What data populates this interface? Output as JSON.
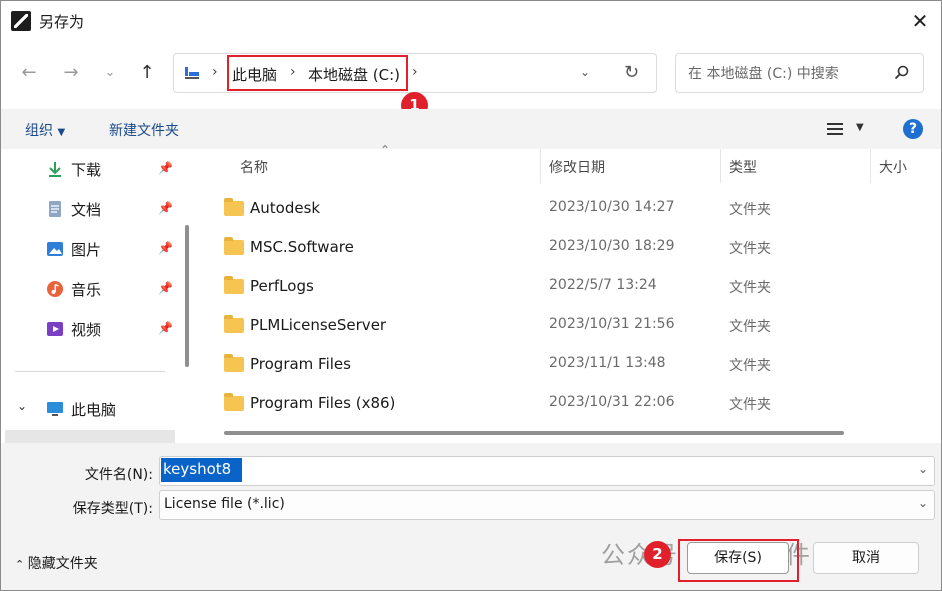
{
  "window": {
    "title": "另存为"
  },
  "nav": {
    "breadcrumbs": [
      "此电脑",
      "本地磁盘 (C:)"
    ],
    "search_placeholder": "在 本地磁盘 (C:) 中搜索"
  },
  "toolbar": {
    "organize": "组织",
    "new_folder": "新建文件夹"
  },
  "sidebar": {
    "items": [
      {
        "label": "下载",
        "icon": "download-icon",
        "pinned": true
      },
      {
        "label": "文档",
        "icon": "document-icon",
        "pinned": true
      },
      {
        "label": "图片",
        "icon": "picture-icon",
        "pinned": true
      },
      {
        "label": "音乐",
        "icon": "music-icon",
        "pinned": true
      },
      {
        "label": "视频",
        "icon": "video-icon",
        "pinned": true
      }
    ],
    "this_pc": "此电脑"
  },
  "file_list": {
    "columns": [
      "名称",
      "修改日期",
      "类型",
      "大小"
    ],
    "rows": [
      {
        "name": "Autodesk",
        "date": "2023/10/30 14:27",
        "type": "文件夹"
      },
      {
        "name": "MSC.Software",
        "date": "2023/10/30 18:29",
        "type": "文件夹"
      },
      {
        "name": "PerfLogs",
        "date": "2022/5/7 13:24",
        "type": "文件夹"
      },
      {
        "name": "PLMLicenseServer",
        "date": "2023/10/31 21:56",
        "type": "文件夹"
      },
      {
        "name": "Program Files",
        "date": "2023/11/1 13:48",
        "type": "文件夹"
      },
      {
        "name": "Program Files (x86)",
        "date": "2023/10/31 22:06",
        "type": "文件夹"
      }
    ]
  },
  "bottom": {
    "filename_label": "文件名(N):",
    "filename_value": "keyshot8",
    "filetype_label": "保存类型(T):",
    "filetype_value": "License file (*.lic)",
    "hide_folders": "隐藏文件夹",
    "save": "保存(S)",
    "cancel": "取消"
  },
  "annotations": {
    "badge1": "1",
    "badge2": "2"
  },
  "watermark": "公众号 · 最全软件管家",
  "colors": {
    "accent": "#0a63c9",
    "highlight": "#e0202a",
    "folder": "#f5c451"
  }
}
